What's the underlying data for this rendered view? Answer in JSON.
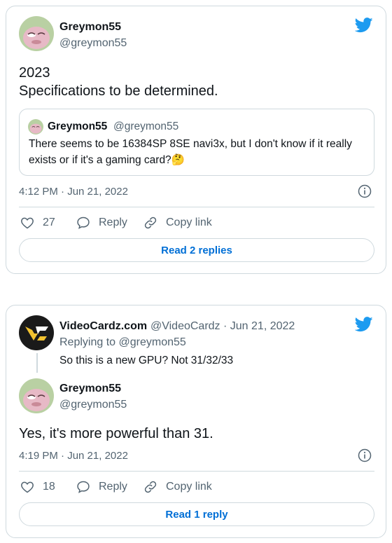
{
  "colors": {
    "twitter_blue": "#1d9bf0",
    "link": "#006fd6",
    "muted": "#536471",
    "border": "#cfd9de"
  },
  "tweet1": {
    "author_name": "Greymon55",
    "author_handle": "@greymon55",
    "text_line1": "2023",
    "text_line2": "Specifications to be determined.",
    "quote": {
      "author_name": "Greymon55",
      "author_handle": "@greymon55",
      "text": "There seems to be 16384SP 8SE navi3x, but I don't know if it really exists or if it's a gaming card?🤔"
    },
    "timestamp": "4:12 PM · Jun 21, 2022",
    "likes": "27",
    "reply_label": "Reply",
    "copy_label": "Copy link",
    "read_replies": "Read 2 replies",
    "icons": [
      "twitter-bird-icon",
      "info-icon",
      "heart-icon",
      "reply-icon",
      "link-icon"
    ]
  },
  "tweet2": {
    "parent": {
      "author_name": "VideoCardz.com",
      "author_handle": "@VideoCardz · Jun 21, 2022",
      "replying_to": "Replying to @greymon55",
      "text": "So this is a new GPU? Not 31/32/33"
    },
    "author_name": "Greymon55",
    "author_handle": "@greymon55",
    "text": "Yes, it's more powerful than 31.",
    "timestamp": "4:19 PM · Jun 21, 2022",
    "likes": "18",
    "reply_label": "Reply",
    "copy_label": "Copy link",
    "read_replies": "Read 1 reply"
  }
}
